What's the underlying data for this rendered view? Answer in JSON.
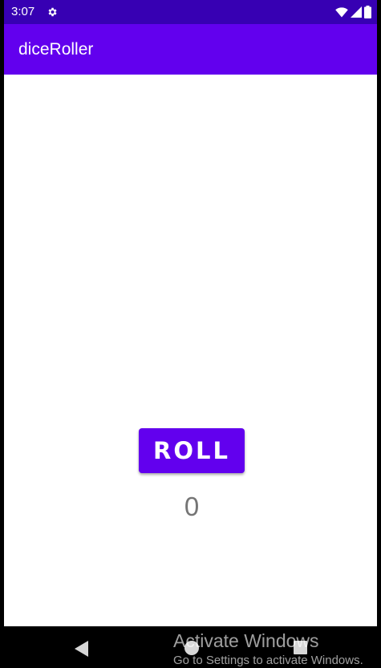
{
  "status_bar": {
    "time": "3:07",
    "icons": [
      "settings-gear-icon",
      "wifi-icon",
      "signal-icon",
      "battery-icon"
    ],
    "background": "#3700b3"
  },
  "app_bar": {
    "title": "diceRoller",
    "background": "#6200ee"
  },
  "main": {
    "roll_button_label": "ROLL",
    "result_value": "0",
    "accent": "#6200ee",
    "result_color": "#757575"
  },
  "nav_bar": {
    "icons": [
      "back-icon",
      "home-icon",
      "recents-icon"
    ]
  },
  "watermark": {
    "title": "Activate Windows",
    "subtitle": "Go to Settings to activate Windows."
  }
}
